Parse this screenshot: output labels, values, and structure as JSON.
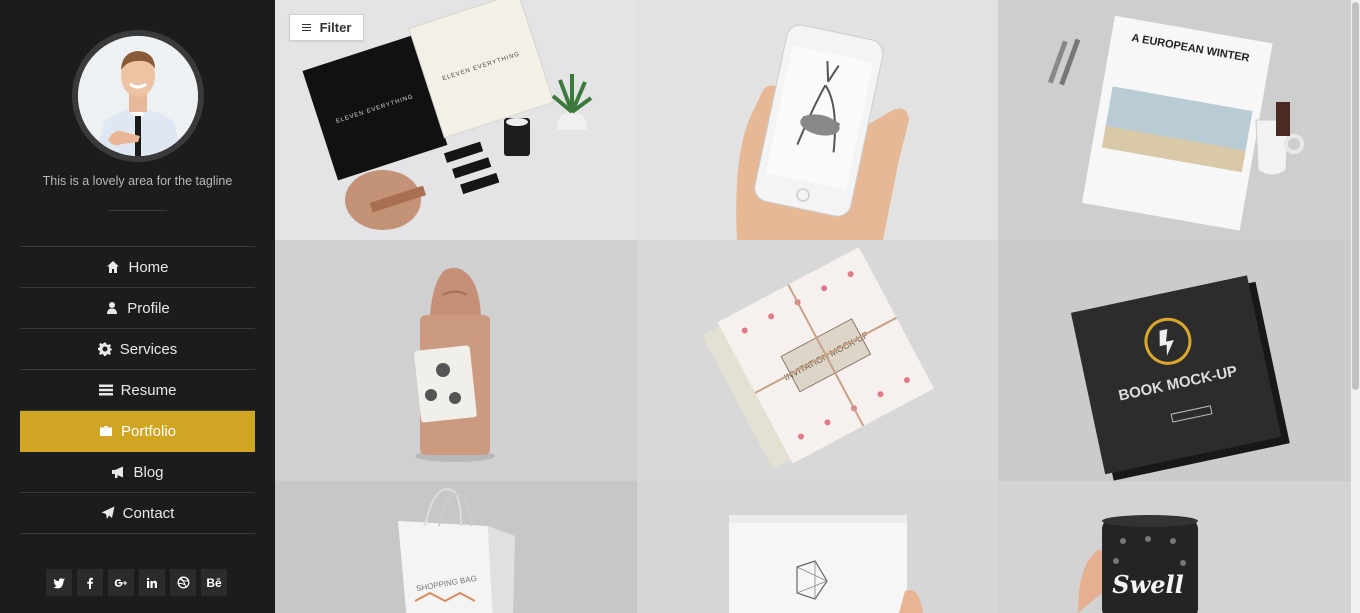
{
  "profile": {
    "tagline": "This is a lovely area for the tagline"
  },
  "nav": {
    "items": [
      {
        "label": "Home",
        "icon": "home-icon"
      },
      {
        "label": "Profile",
        "icon": "user-icon"
      },
      {
        "label": "Services",
        "icon": "gear-icon"
      },
      {
        "label": "Resume",
        "icon": "list-icon"
      },
      {
        "label": "Portfolio",
        "icon": "briefcase-icon",
        "active": true
      },
      {
        "label": "Blog",
        "icon": "megaphone-icon"
      },
      {
        "label": "Contact",
        "icon": "paper-plane-icon"
      }
    ]
  },
  "social": [
    "twitter-icon",
    "facebook-icon",
    "google-plus-icon",
    "linkedin-icon",
    "dribbble-icon",
    "behance-icon"
  ],
  "portfolio": {
    "filter_label": "Filter",
    "items": [
      {
        "name": "eleven-everything-branding",
        "print": "ELEVEN EVERYTHING"
      },
      {
        "name": "phone-deer"
      },
      {
        "name": "european-winter-magazine",
        "print": "A EUROPEAN WINTER"
      },
      {
        "name": "paper-package"
      },
      {
        "name": "invitation-mockup",
        "print": "INVITATION MOCK-UP"
      },
      {
        "name": "book-mockup",
        "print": "BOOK MOCK-UP"
      },
      {
        "name": "shopping-bag",
        "print": "SHOPPING BAG"
      },
      {
        "name": "white-book"
      },
      {
        "name": "swell-cup",
        "print": "Swell"
      }
    ]
  },
  "colors": {
    "sidebar_bg": "#1c1c1c",
    "accent": "#d0a524",
    "nav_border": "#3a3a3a"
  }
}
